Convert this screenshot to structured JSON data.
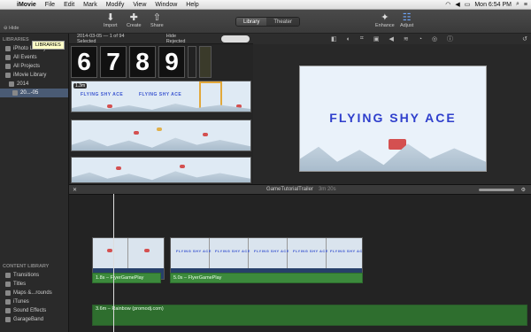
{
  "menubar": {
    "app": "iMovie",
    "items": [
      "File",
      "Edit",
      "Mark",
      "Modify",
      "View",
      "Window",
      "Help"
    ],
    "clock": "Mon 6:54 PM"
  },
  "toolbar": {
    "hide_label": "Hide",
    "import_label": "Import",
    "create_label": "Create",
    "share_label": "Share",
    "library_tab": "Library",
    "theater_tab": "Theater",
    "enhance_label": "Enhance",
    "adjust_label": "Adjust"
  },
  "sidebar": {
    "libraries_header": "LIBRARIES",
    "items": [
      {
        "label": "iPhoto Library"
      },
      {
        "label": "All Events"
      },
      {
        "label": "All Projects"
      },
      {
        "label": "iMovie Library"
      },
      {
        "label": "2014"
      },
      {
        "label": "20...-05"
      }
    ],
    "tooltip": "LIBRARIES",
    "content_header": "CONTENT LIBRARY",
    "content_items": [
      {
        "label": "Transitions"
      },
      {
        "label": "Titles"
      },
      {
        "label": "Maps &...rounds"
      },
      {
        "label": "iTunes"
      },
      {
        "label": "Sound Effects"
      },
      {
        "label": "GarageBand"
      }
    ]
  },
  "browser": {
    "date_info": "2014-03-05 — 1 of 94 Selected",
    "filter": "Hide Rejected",
    "clip_title": "FLYING SHY ACE",
    "duration_badge": "1.3m",
    "digits": [
      "6",
      "7",
      "8",
      "9"
    ]
  },
  "viewer": {
    "preview_title": "FLYING SHY ACE"
  },
  "timeline": {
    "project_name": "GameTutorialTrailer",
    "project_duration": "3m 20s",
    "clip1_audio": "1.8s – FlyerGamePlay",
    "clip2_audio": "5.0s – FlyerGamePlay",
    "music": "3.6m – Rainbow (promodj.com)"
  },
  "colors": {
    "accent": "#4a5b74",
    "title_blue": "#2f3fcc",
    "audio_green": "#3c8a3c"
  }
}
